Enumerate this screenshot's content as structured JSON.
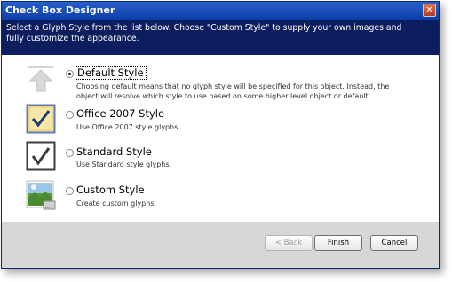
{
  "window": {
    "title": "Check Box Designer",
    "close_label": "✕"
  },
  "header": {
    "instructions": "Select a Glyph Style from the list below. Choose \"Custom Style\" to supply your own images and fully customize the appearance."
  },
  "options": [
    {
      "label": "Default Style",
      "description": "Choosing default means that no glyph style will be specified for this object. Instead, the object will resolve which style to use based on some higher level object or default.",
      "icon": "up-arrow-icon",
      "selected": true
    },
    {
      "label": "Office 2007 Style",
      "description": "Use Office 2007 style glyphs.",
      "icon": "office-2007-checkbox-icon",
      "selected": false
    },
    {
      "label": "Standard Style",
      "description": "Use Standard style glyphs.",
      "icon": "standard-checkbox-icon",
      "selected": false
    },
    {
      "label": "Custom Style",
      "description": "Create custom glyphs.",
      "icon": "custom-image-icon",
      "selected": false
    }
  ],
  "buttons": {
    "back": "< Back",
    "finish": "Finish",
    "cancel": "Cancel"
  },
  "colors": {
    "titlebar": "#0b3ea8",
    "header": "#0d1e5e",
    "footer": "#d7d7d7"
  }
}
